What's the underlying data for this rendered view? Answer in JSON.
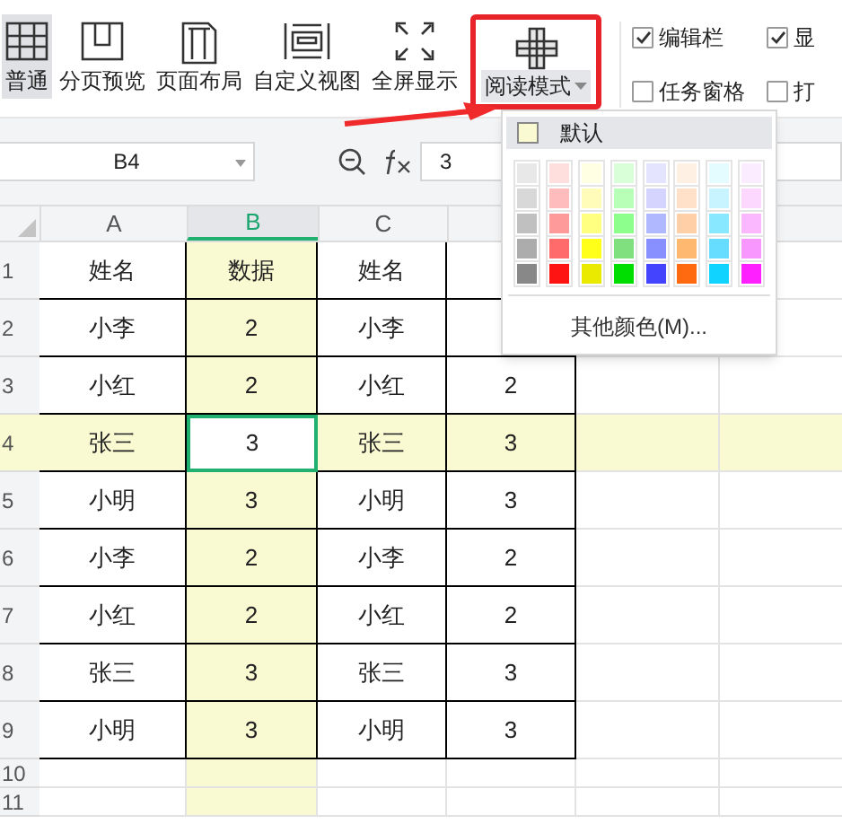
{
  "ribbon": {
    "views": [
      {
        "label": "普通",
        "kind": "grid",
        "selected": true
      },
      {
        "label": "分页预览",
        "kind": "pages",
        "selected": false
      },
      {
        "label": "页面布局",
        "kind": "layout",
        "selected": false
      },
      {
        "label": "自定义视图",
        "kind": "custom",
        "selected": false
      },
      {
        "label": "全屏显示",
        "kind": "fullscreen",
        "selected": false
      },
      {
        "label": "阅读模式",
        "kind": "reading",
        "selected": false
      }
    ],
    "options": [
      {
        "label": "编辑栏",
        "checked": true
      },
      {
        "label": "显",
        "checked": true
      },
      {
        "label": "任务窗格",
        "checked": false
      },
      {
        "label": "打",
        "checked": false
      }
    ]
  },
  "formula_bar": {
    "cell": "B4",
    "value": "3"
  },
  "sheet": {
    "columns": [
      {
        "label": "A",
        "selected": false
      },
      {
        "label": "B",
        "selected": true
      },
      {
        "label": "C",
        "selected": false
      }
    ],
    "rows": [
      {
        "header": "1",
        "selected": false,
        "cells": [
          "姓名",
          "数据",
          "姓名"
        ]
      },
      {
        "header": "2",
        "selected": false,
        "cells": [
          "小李",
          "2",
          "小李"
        ]
      },
      {
        "header": "3",
        "selected": false,
        "cells": [
          "小红",
          "2",
          "小红",
          "2"
        ]
      },
      {
        "header": "4",
        "selected": true,
        "cells": [
          "张三",
          "3",
          "张三",
          "3"
        ]
      },
      {
        "header": "5",
        "selected": false,
        "cells": [
          "小明",
          "3",
          "小明",
          "3"
        ]
      },
      {
        "header": "6",
        "selected": false,
        "cells": [
          "小李",
          "2",
          "小李",
          "2"
        ]
      },
      {
        "header": "7",
        "selected": false,
        "cells": [
          "小红",
          "2",
          "小红",
          "2"
        ]
      },
      {
        "header": "8",
        "selected": false,
        "cells": [
          "张三",
          "3",
          "张三",
          "3"
        ]
      },
      {
        "header": "9",
        "selected": false,
        "cells": [
          "小明",
          "3",
          "小明",
          "3"
        ]
      },
      {
        "header": "10",
        "selected": false,
        "cells": []
      },
      {
        "header": "11",
        "selected": false,
        "cells": []
      }
    ]
  },
  "color_menu": {
    "default": {
      "label": "默认",
      "color": "#fafad2",
      "selected": true
    },
    "swatches": [
      {
        "color": "#e8e8e8"
      },
      {
        "color": "#ffdede"
      },
      {
        "color": "#ffffe4"
      },
      {
        "color": "#d8ffd8"
      },
      {
        "color": "#e4e4ff"
      },
      {
        "color": "#fff0e4"
      },
      {
        "color": "#e4fbff"
      },
      {
        "color": "#fcecff"
      },
      {
        "color": "#d8d8d8"
      },
      {
        "color": "#ffbcbc"
      },
      {
        "color": "#fffbb8"
      },
      {
        "color": "#b8ffb8"
      },
      {
        "color": "#d4d4ff"
      },
      {
        "color": "#ffe0c8"
      },
      {
        "color": "#c8f4ff"
      },
      {
        "color": "#fcd8ff"
      },
      {
        "color": "#c0c0c0"
      },
      {
        "color": "#ff9a9a"
      },
      {
        "color": "#ffff80"
      },
      {
        "color": "#8cff8c"
      },
      {
        "color": "#b0b8ff"
      },
      {
        "color": "#ffd0a8"
      },
      {
        "color": "#88e8ff"
      },
      {
        "color": "#fcb8ff"
      },
      {
        "color": "#acacac"
      },
      {
        "color": "#ff6b6b"
      },
      {
        "color": "#ffff1a"
      },
      {
        "color": "#80e080"
      },
      {
        "color": "#8890ff"
      },
      {
        "color": "#ffb870"
      },
      {
        "color": "#66dcff"
      },
      {
        "color": "#f898ff"
      },
      {
        "color": "#888888"
      },
      {
        "color": "#ff1414"
      },
      {
        "color": "#eaea00"
      },
      {
        "color": "#00dd00"
      },
      {
        "color": "#4444ff"
      },
      {
        "color": "#ff6a10"
      },
      {
        "color": "#10d4ff"
      },
      {
        "color": "#ff20ff"
      }
    ],
    "more": "其他颜色(M)..."
  }
}
